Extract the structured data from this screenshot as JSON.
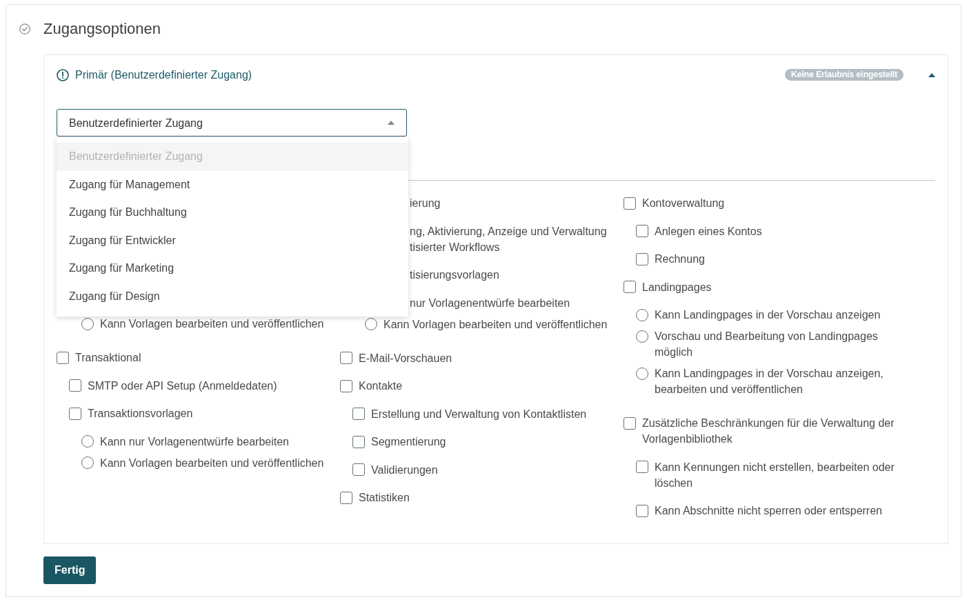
{
  "section": {
    "title": "Zugangsoptionen"
  },
  "panel": {
    "title": "Primär (Benutzerdefinierter Zugang)",
    "badge": "Keine Erlaubnis eingestellt",
    "expanded": true,
    "access_select": {
      "value": "Benutzerdefinierter Zugang",
      "open": true
    },
    "dropdown_options": [
      {
        "label": "Benutzerdefinierter Zugang",
        "selected": true
      },
      {
        "label": "Zugang für Management",
        "selected": false
      },
      {
        "label": "Zugang für Buchhaltung",
        "selected": false
      },
      {
        "label": "Zugang für Entwickler",
        "selected": false
      },
      {
        "label": "Zugang für Marketing",
        "selected": false
      },
      {
        "label": "Zugang für Design",
        "selected": false
      }
    ],
    "permission_columns": [
      {
        "items": [
          {
            "kind": "covered",
            "children": [
              {
                "kind": "covered",
                "children": [
                  {
                    "kind": "radio",
                    "label": "Kann Vorlagen bearbeiten und veröffentlichen",
                    "selected": false
                  }
                ]
              }
            ]
          },
          {
            "kind": "checkbox",
            "label": "Transaktional",
            "checked": false,
            "children": [
              {
                "kind": "checkbox",
                "label": "SMTP oder API Setup (Anmeldedaten)",
                "checked": false
              },
              {
                "kind": "checkbox",
                "label": "Transaktionsvorlagen",
                "checked": false,
                "children": [
                  {
                    "kind": "radio",
                    "label": "Kann nur Vorlagenentwürfe bearbeiten",
                    "selected": false
                  },
                  {
                    "kind": "radio",
                    "label": "Kann Vorlagen bearbeiten und veröffentlichen",
                    "selected": false
                  }
                ]
              }
            ]
          }
        ]
      },
      {
        "items": [
          {
            "kind": "covered",
            "visible_text": [
              "ierung"
            ],
            "children": [
              {
                "kind": "covered",
                "visible_text": [
                  "ng, Aktivierung, Anzeige und Verwaltung",
                  "tisierter Workflows"
                ]
              },
              {
                "kind": "covered",
                "visible_text": [
                  "tisierungsvorlagen"
                ],
                "children": [
                  {
                    "kind": "covered",
                    "visible_text": [
                      "nur Vorlagenentwürfe bearbeiten"
                    ]
                  },
                  {
                    "kind": "radio",
                    "label": "Kann Vorlagen bearbeiten und veröffentlichen",
                    "selected": false
                  }
                ]
              }
            ]
          },
          {
            "kind": "checkbox",
            "label": "E-Mail-Vorschauen",
            "checked": false
          },
          {
            "kind": "checkbox",
            "label": "Kontakte",
            "checked": false,
            "children": [
              {
                "kind": "checkbox",
                "label": "Erstellung und Verwaltung von Kontaktlisten",
                "checked": false
              },
              {
                "kind": "checkbox",
                "label": "Segmentierung",
                "checked": false
              },
              {
                "kind": "checkbox",
                "label": "Validierungen",
                "checked": false
              }
            ]
          },
          {
            "kind": "checkbox",
            "label": "Statistiken",
            "checked": false
          }
        ]
      },
      {
        "items": [
          {
            "kind": "checkbox",
            "label": "Kontoverwaltung",
            "checked": false,
            "children": [
              {
                "kind": "checkbox",
                "label": "Anlegen eines Kontos",
                "checked": false
              },
              {
                "kind": "checkbox",
                "label": "Rechnung",
                "checked": false
              }
            ]
          },
          {
            "kind": "checkbox",
            "label": "Landingpages",
            "checked": false,
            "children": [
              {
                "kind": "radio",
                "label": "Kann Landingpages in der Vorschau anzeigen",
                "selected": false
              },
              {
                "kind": "radio",
                "label": "Vorschau und Bearbeitung von Landingpages möglich",
                "selected": false
              },
              {
                "kind": "radio",
                "label": "Kann Landingpages in der Vorschau anzeigen, bearbeiten und veröffentlichen",
                "selected": false
              }
            ]
          },
          {
            "kind": "checkbox",
            "label": "Zusätzliche Beschränkungen für die Verwaltung der Vorlagenbibliothek",
            "checked": false,
            "children": [
              {
                "kind": "checkbox",
                "label": "Kann Kennungen nicht erstellen, bearbeiten oder löschen",
                "checked": false
              },
              {
                "kind": "checkbox",
                "label": "Kann Abschnitte nicht sperren oder entsperren",
                "checked": false
              }
            ]
          }
        ]
      }
    ]
  },
  "done_button": {
    "label": "Fertig"
  }
}
